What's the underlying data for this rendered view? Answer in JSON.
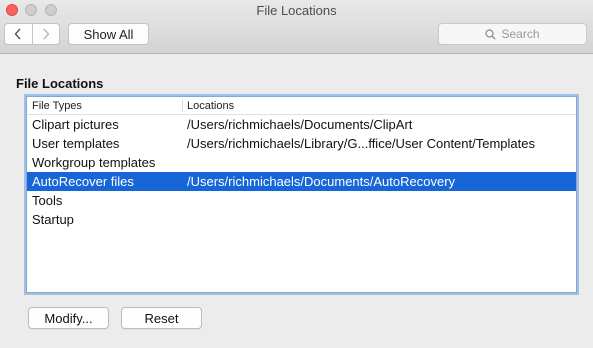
{
  "window": {
    "title": "File Locations"
  },
  "toolbar": {
    "back_icon": "chevron-left-icon",
    "forward_icon": "chevron-right-icon",
    "show_all_label": "Show All",
    "search_placeholder": "Search"
  },
  "section": {
    "title": "File Locations"
  },
  "table": {
    "columns": [
      "File Types",
      "Locations"
    ],
    "rows": [
      {
        "type": "Clipart pictures",
        "location": "/Users/richmichaels/Documents/ClipArt"
      },
      {
        "type": "User templates",
        "location": "/Users/richmichaels/Library/G...ffice/User Content/Templates"
      },
      {
        "type": "Workgroup templates",
        "location": ""
      },
      {
        "type": "AutoRecover files",
        "location": "/Users/richmichaels/Documents/AutoRecovery"
      },
      {
        "type": "Tools",
        "location": ""
      },
      {
        "type": "Startup",
        "location": ""
      }
    ],
    "selected_row": "AutoRecover files"
  },
  "buttons": {
    "modify_label": "Modify...",
    "reset_label": "Reset"
  },
  "colors": {
    "selection": "#1766d8",
    "close_button": "#fc615d",
    "focus_ring": "#9ec1ea"
  }
}
